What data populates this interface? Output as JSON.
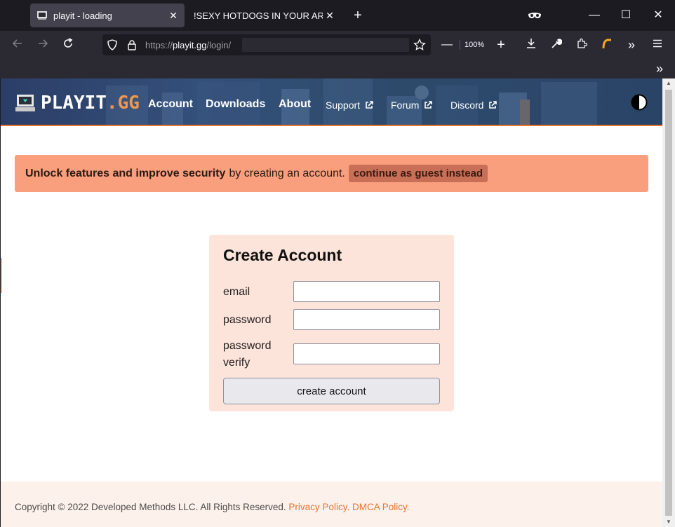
{
  "browser": {
    "tabs": [
      {
        "title": "playit - loading",
        "close": "✕",
        "active": true
      },
      {
        "title": "!SEXY HOTDOGS IN YOUR AREA!!SEXY",
        "close": "✕",
        "active": false
      }
    ],
    "new_tab": "+",
    "window_controls": {
      "minimize": "—",
      "maximize": "☐",
      "close": "✕"
    },
    "url_prefix": "https://",
    "url_host": "playit.gg",
    "url_path": "/login/",
    "zoom_minus": "—",
    "zoom": "100%",
    "zoom_plus": "+",
    "overflow": "»"
  },
  "site": {
    "logo": {
      "main": "PLAYIT",
      "accent": ".GG"
    },
    "nav": [
      {
        "label": "Account"
      },
      {
        "label": "Downloads"
      },
      {
        "label": "About"
      }
    ],
    "external_nav": [
      {
        "label": "Support"
      },
      {
        "label": "Forum"
      },
      {
        "label": "Discord"
      }
    ],
    "accent_color": "#e8742f"
  },
  "banner": {
    "strong": "Unlock features and improve security",
    "text": "by creating an account.",
    "guest_button": "continue as guest instead"
  },
  "form": {
    "title": "Create Account",
    "email_label": "email",
    "password_label": "password",
    "password_verify_label": "password verify",
    "email_value": "",
    "password_value": "",
    "password_verify_value": "",
    "submit_label": "create account"
  },
  "footer": {
    "copyright": "Copyright © 2022 Developed Methods LLC. All Rights Reserved.",
    "privacy_link": "Privacy Policy.",
    "dmca_link": "DMCA Policy."
  }
}
